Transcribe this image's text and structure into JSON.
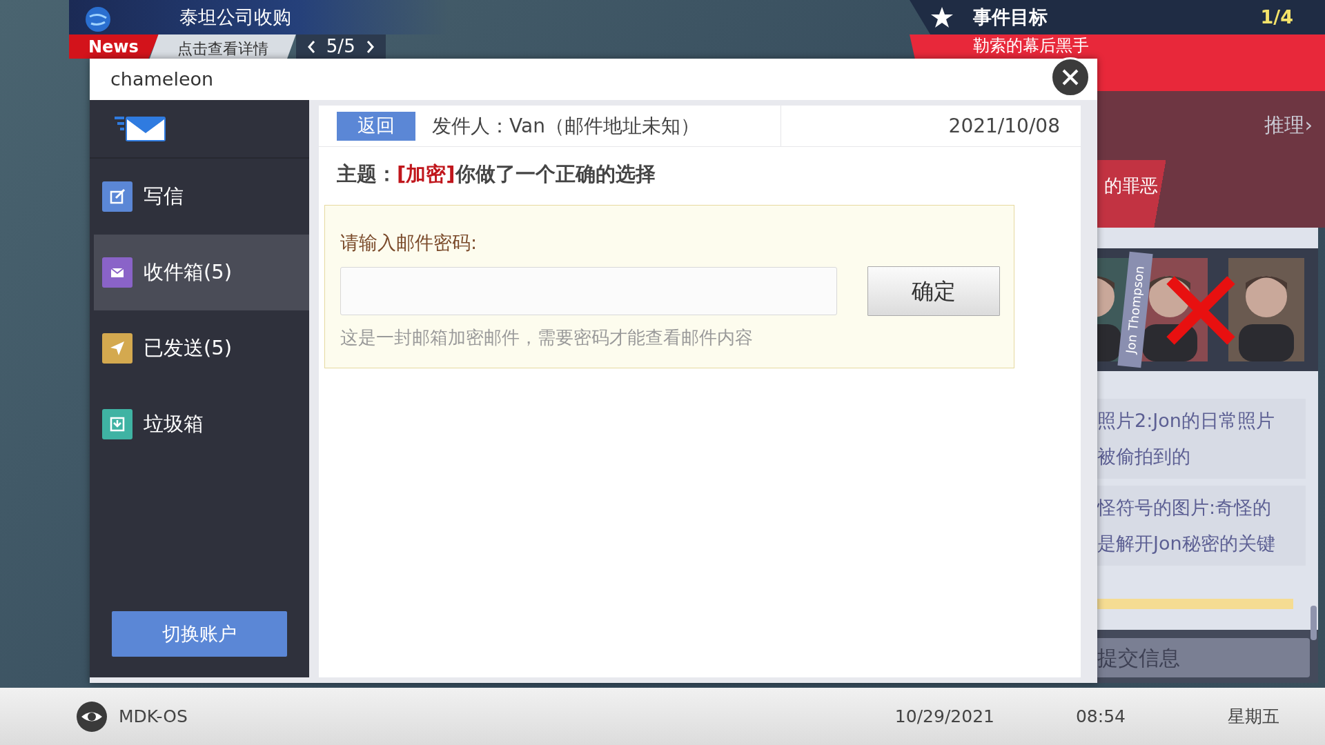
{
  "news_ticker": {
    "headline": "泰坦公司收购",
    "label": "News",
    "link": "点击查看详情",
    "page": "5/5"
  },
  "objective": {
    "title": "事件目标",
    "progress": "1/4",
    "current": "勒索的幕后黑手",
    "reasoning": "推理›",
    "item": "的罪恶"
  },
  "evidence": {
    "portrait_label": "Jon Thompson",
    "notes": [
      {
        "lines": [
          "照片2:Jon的日常照片",
          "被偷拍到的"
        ]
      },
      {
        "lines": [
          "怪符号的图片:奇怪的",
          "是解开Jon秘密的关键"
        ]
      }
    ],
    "submit": "提交信息"
  },
  "mail_window": {
    "title": "chameleon",
    "folders": [
      {
        "label": "写信",
        "kind": "compose",
        "selected": false
      },
      {
        "label": "收件箱(5)",
        "kind": "inbox",
        "selected": true
      },
      {
        "label": "已发送(5)",
        "kind": "sent",
        "selected": false
      },
      {
        "label": "垃圾箱",
        "kind": "trash",
        "selected": false
      }
    ],
    "switch_account": "切换账户",
    "message": {
      "back": "返回",
      "sender": "发件人：Van（邮件地址未知）",
      "date": "2021/10/08",
      "subject": "主题：**[加密]**你做了一个正确的选择",
      "password_prompt": {
        "label": "请输入邮件密码:",
        "confirm": "确定",
        "hint": "这是一封邮箱加密邮件，需要密码才能查看邮件内容"
      }
    }
  },
  "taskbar": {
    "os": "MDK-OS",
    "date": "10/29/2021",
    "time": "08:54",
    "weekday": "星期五"
  }
}
